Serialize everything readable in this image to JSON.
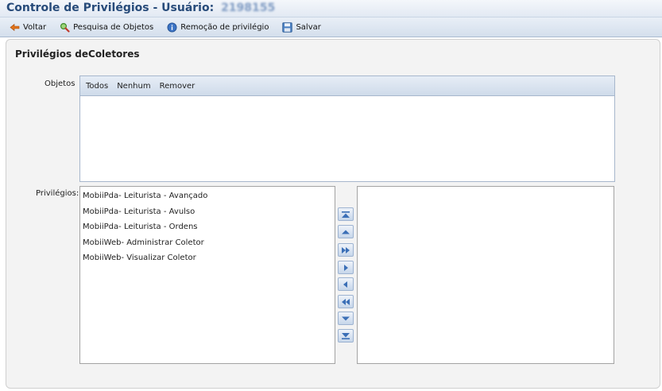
{
  "window": {
    "title": "Controle de Privilégios - Usuário:",
    "user_id": "2198155"
  },
  "toolbar": {
    "back_label": "Voltar",
    "search_label": "Pesquisa de Objetos",
    "remove_label": "Remoção de privilégio",
    "save_label": "Salvar"
  },
  "panel": {
    "title": "Privilégios deColetores",
    "objetos_label": "Objetos",
    "privilegios_label": "Privilégios:"
  },
  "objetos_header": {
    "all_label": "Todos",
    "none_label": "Nenhum",
    "remove_label": "Remover"
  },
  "available_privileges": [
    "MobiiPda- Leiturista - Avançado",
    "MobiiPda- Leiturista - Avulso",
    "MobiiPda- Leiturista - Ordens",
    "MobiiWeb- Administrar Coletor",
    "MobiiWeb- Visualizar Coletor"
  ],
  "selected_privileges": [],
  "colors": {
    "title_text": "#274b7a",
    "header_gradient_top": "#e6edf6",
    "header_gradient_bottom": "#cfdbea",
    "button_icon": "#3b6fb6"
  },
  "move_buttons": [
    "move-top-icon",
    "move-up-icon",
    "move-all-right-icon",
    "move-right-icon",
    "move-left-icon",
    "move-all-left-icon",
    "move-down-icon",
    "move-bottom-icon"
  ]
}
